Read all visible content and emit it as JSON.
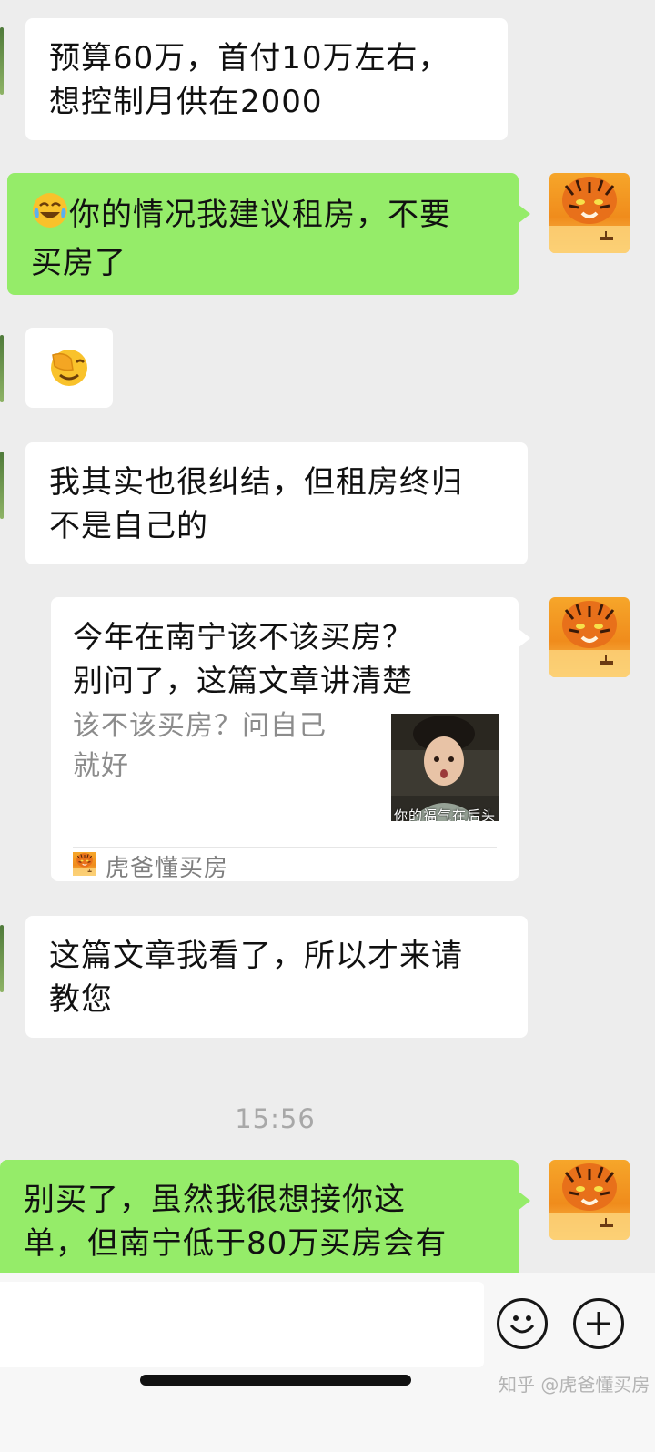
{
  "messages": [
    {
      "side": "left",
      "lines": [
        "预算60万，首付10万左右，",
        "想控制月供在2000"
      ]
    },
    {
      "side": "right",
      "emoji": "joy-emoji",
      "lines": [
        "你的情况我建议租房，不要",
        "买房了"
      ]
    },
    {
      "side": "left",
      "emoji": "facepalm-emoji"
    },
    {
      "side": "left",
      "lines": [
        "我其实也很纠结，但租房终归",
        "不是自己的"
      ]
    },
    {
      "side": "right",
      "type": "article-card",
      "title_lines": [
        "今年在南宁该不该买房？",
        "别问了，这篇文章讲清楚"
      ],
      "desc_lines": [
        "该不该买房？问自己",
        "就好"
      ],
      "thumb_caption": "你的福气在后头",
      "source": "虎爸懂买房"
    },
    {
      "side": "left",
      "lines": [
        "这篇文章我看了，所以才来请",
        "教您"
      ]
    },
    {
      "side": "right",
      "lines": [
        "别买了，虽然我很想接你这",
        "单，但南宁低于80万买房会有"
      ]
    }
  ],
  "timestamp": "15:56",
  "input_bar": {
    "emoji_icon": "smiley-face-icon",
    "plus_icon": "plus-icon"
  },
  "watermark": "知乎 @虎爸懂买房",
  "colors": {
    "background": "#ededed",
    "sent_bubble": "#95ec69",
    "received_bubble": "#ffffff"
  }
}
